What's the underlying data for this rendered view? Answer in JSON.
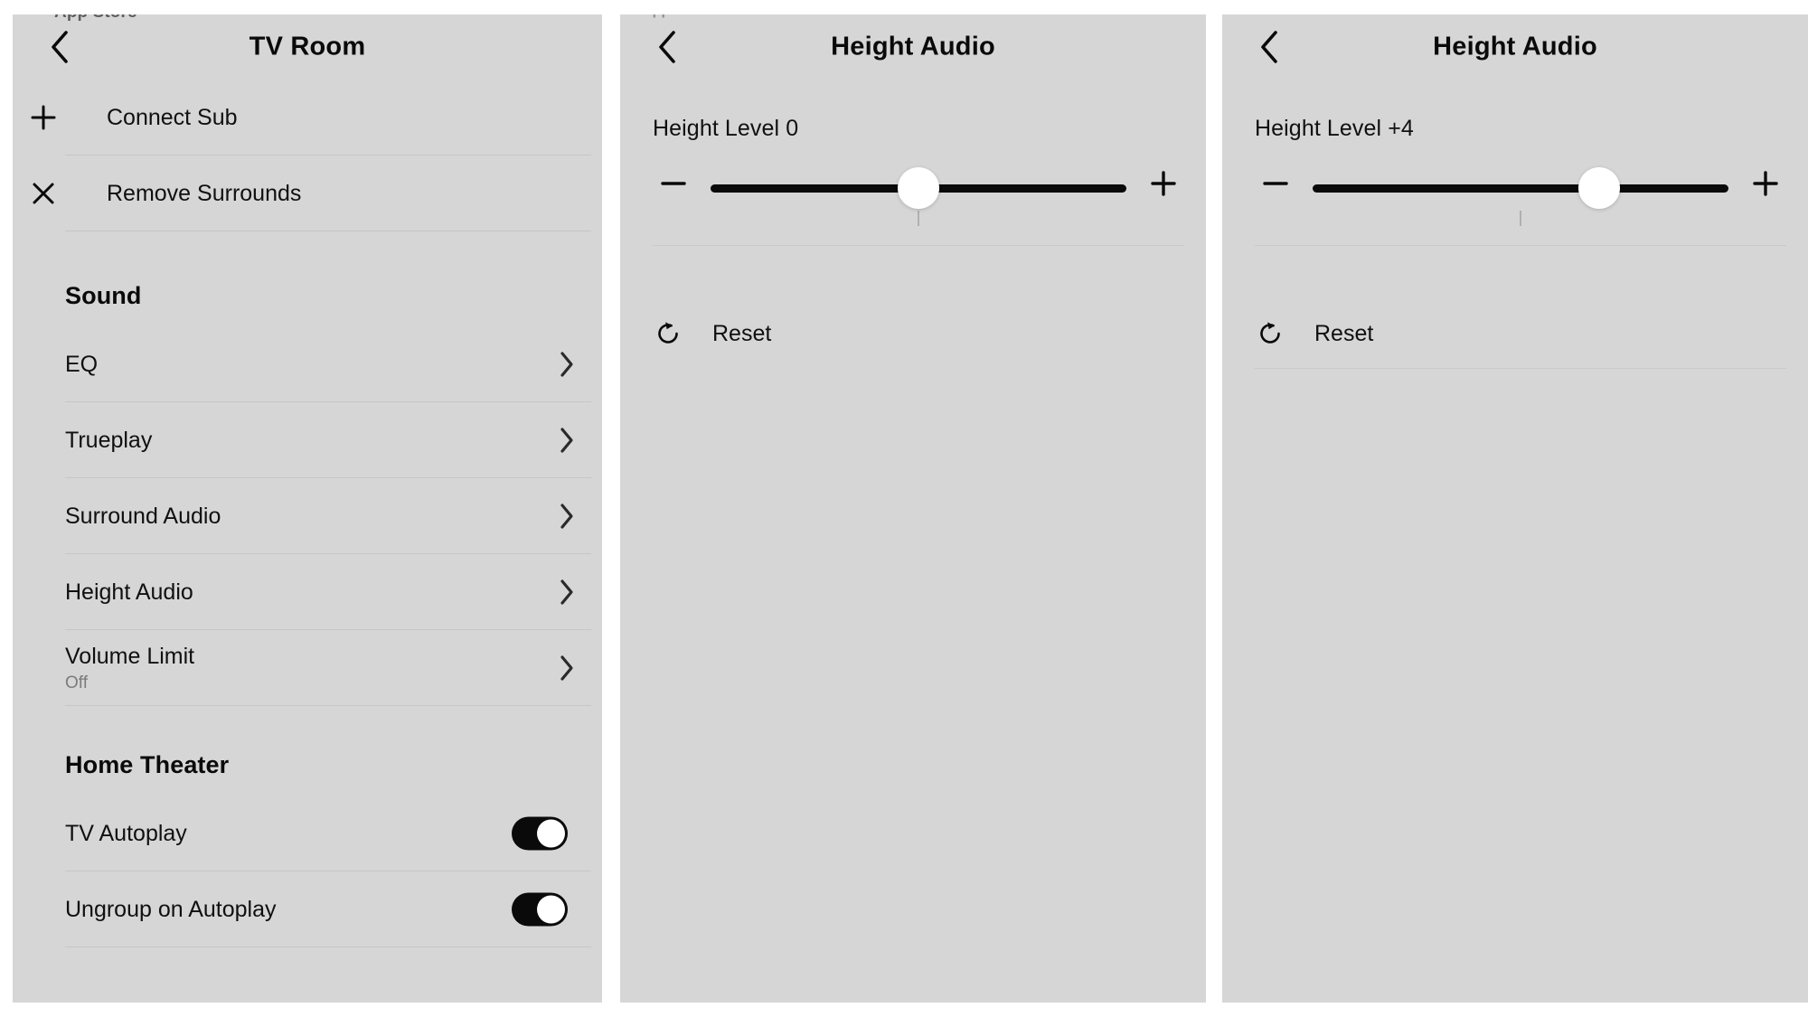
{
  "theme": {
    "panel_bg": "#d6d6d6",
    "page_bg": "#ffffff",
    "text": "#101010",
    "muted_text": "#7b7b7b",
    "divider": "#c6c6c6",
    "accent": "#0a0a0a",
    "knob": "#ffffff"
  },
  "ghost_status_label": "App Store",
  "panel1": {
    "nav": {
      "back_icon": "chevron-left-icon",
      "title": "TV Room"
    },
    "actions": [
      {
        "icon": "plus-icon",
        "label": "Connect Sub"
      },
      {
        "icon": "close-icon",
        "label": "Remove Surrounds"
      }
    ],
    "sound_section": {
      "title": "Sound",
      "items": [
        {
          "label": "EQ",
          "sub": "",
          "chevron": "chevron-right-icon"
        },
        {
          "label": "Trueplay",
          "sub": "",
          "chevron": "chevron-right-icon"
        },
        {
          "label": "Surround Audio",
          "sub": "",
          "chevron": "chevron-right-icon"
        },
        {
          "label": "Height Audio",
          "sub": "",
          "chevron": "chevron-right-icon"
        },
        {
          "label": "Volume Limit",
          "sub": "Off",
          "chevron": "chevron-right-icon"
        }
      ]
    },
    "home_theater_section": {
      "title": "Home Theater",
      "items": [
        {
          "label": "TV Autoplay",
          "state": "on"
        },
        {
          "label": "Ungroup on Autoplay",
          "state": "on"
        }
      ]
    }
  },
  "panel2": {
    "nav": {
      "back_icon": "chevron-left-icon",
      "title": "Height Audio"
    },
    "slider": {
      "level_label": "Height Level 0",
      "value": 0,
      "min": -5,
      "max": 5,
      "thumb_percent": 50,
      "decrease_icon": "minus-icon",
      "increase_icon": "plus-icon",
      "center_tick": true
    },
    "reset": {
      "icon": "reset-icon",
      "label": "Reset"
    }
  },
  "panel3": {
    "nav": {
      "back_icon": "chevron-left-icon",
      "title": "Height Audio"
    },
    "slider": {
      "level_label": "Height Level +4",
      "value": 4,
      "min": -5,
      "max": 5,
      "thumb_percent": 69,
      "decrease_icon": "minus-icon",
      "increase_icon": "plus-icon",
      "center_tick": true
    },
    "reset": {
      "icon": "reset-icon",
      "label": "Reset"
    }
  }
}
